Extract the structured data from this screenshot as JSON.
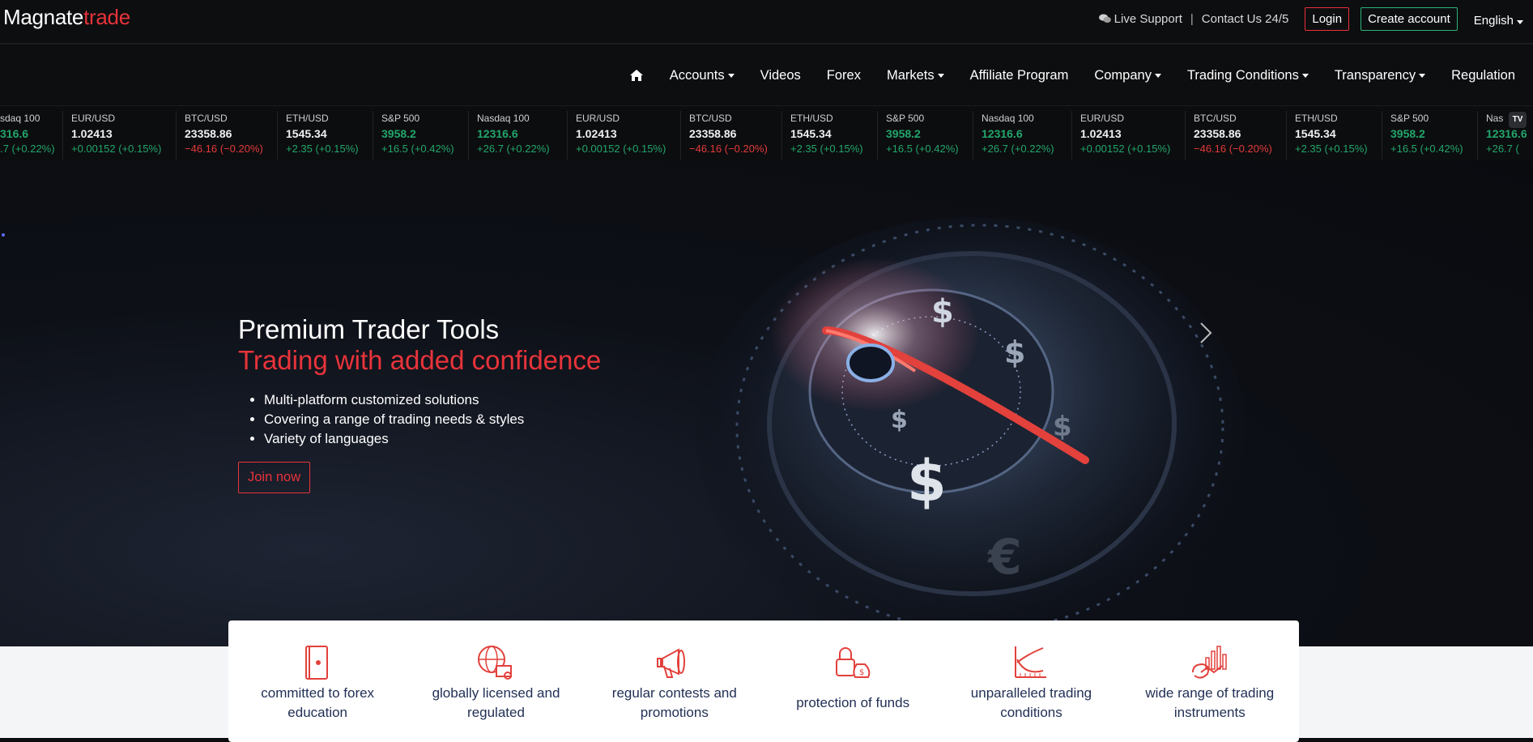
{
  "brand": {
    "part1": "Magnate",
    "part2": "trade"
  },
  "topbar": {
    "live_support": "Live Support",
    "separator": "|",
    "contact": "Contact Us 24/5",
    "login": "Login",
    "create_account": "Create account",
    "language": "English"
  },
  "nav": {
    "items": [
      {
        "label": "Accounts",
        "dropdown": true
      },
      {
        "label": "Videos",
        "dropdown": false
      },
      {
        "label": "Forex",
        "dropdown": false
      },
      {
        "label": "Markets",
        "dropdown": true
      },
      {
        "label": "Affiliate Program",
        "dropdown": false
      },
      {
        "label": "Company",
        "dropdown": true
      },
      {
        "label": "Trading Conditions",
        "dropdown": true
      },
      {
        "label": "Transparency",
        "dropdown": true
      },
      {
        "label": "Regulation",
        "dropdown": false
      }
    ]
  },
  "ticker": {
    "items": [
      {
        "symbol": "sdaq 100",
        "price": "316.6",
        "change": ".7 (+0.22%)",
        "dir": "pos",
        "price_color": "pos"
      },
      {
        "symbol": "EUR/USD",
        "price": "1.02413",
        "change": "+0.00152 (+0.15%)",
        "dir": "pos",
        "price_color": "white"
      },
      {
        "symbol": "BTC/USD",
        "price": "23358.86",
        "change": "−46.16 (−0.20%)",
        "dir": "neg",
        "price_color": "white"
      },
      {
        "symbol": "ETH/USD",
        "price": "1545.34",
        "change": "+2.35 (+0.15%)",
        "dir": "pos",
        "price_color": "white"
      },
      {
        "symbol": "S&P 500",
        "price": "3958.2",
        "change": "+16.5 (+0.42%)",
        "dir": "pos",
        "price_color": "pos"
      },
      {
        "symbol": "Nasdaq 100",
        "price": "12316.6",
        "change": "+26.7 (+0.22%)",
        "dir": "pos",
        "price_color": "pos"
      },
      {
        "symbol": "EUR/USD",
        "price": "1.02413",
        "change": "+0.00152 (+0.15%)",
        "dir": "pos",
        "price_color": "white"
      },
      {
        "symbol": "BTC/USD",
        "price": "23358.86",
        "change": "−46.16 (−0.20%)",
        "dir": "neg",
        "price_color": "white"
      },
      {
        "symbol": "ETH/USD",
        "price": "1545.34",
        "change": "+2.35 (+0.15%)",
        "dir": "pos",
        "price_color": "white"
      },
      {
        "symbol": "S&P 500",
        "price": "3958.2",
        "change": "+16.5 (+0.42%)",
        "dir": "pos",
        "price_color": "pos"
      },
      {
        "symbol": "Nasdaq 100",
        "price": "12316.6",
        "change": "+26.7 (+0.22%)",
        "dir": "pos",
        "price_color": "pos"
      },
      {
        "symbol": "EUR/USD",
        "price": "1.02413",
        "change": "+0.00152 (+0.15%)",
        "dir": "pos",
        "price_color": "white"
      },
      {
        "symbol": "BTC/USD",
        "price": "23358.86",
        "change": "−46.16 (−0.20%)",
        "dir": "neg",
        "price_color": "white"
      },
      {
        "symbol": "ETH/USD",
        "price": "1545.34",
        "change": "+2.35 (+0.15%)",
        "dir": "pos",
        "price_color": "white"
      },
      {
        "symbol": "S&P 500",
        "price": "3958.2",
        "change": "+16.5 (+0.42%)",
        "dir": "pos",
        "price_color": "pos"
      },
      {
        "symbol": "Nas",
        "price": "12316.6",
        "change": "+26.7 (",
        "dir": "pos",
        "price_color": "pos"
      }
    ]
  },
  "hero": {
    "title": "Premium Trader Tools",
    "subtitle": "Trading with added confidence",
    "bullets": [
      "Multi-platform customized solutions",
      "Covering a range of trading needs & styles",
      "Variety of languages"
    ],
    "cta": "Join now"
  },
  "features": [
    {
      "icon": "book-icon",
      "line1": "committed to forex",
      "line2": "education"
    },
    {
      "icon": "globe-certificate-icon",
      "line1": "globally licensed and",
      "line2": "regulated"
    },
    {
      "icon": "megaphone-icon",
      "line1": "regular contests and",
      "line2": "promotions"
    },
    {
      "icon": "lock-moneybag-icon",
      "line1": "protection of funds",
      "line2": ""
    },
    {
      "icon": "chart-growth-icon",
      "line1": "unparalleled trading",
      "line2": "conditions"
    },
    {
      "icon": "instruments-chart-icon",
      "line1": "wide range of trading",
      "line2": "instruments"
    }
  ],
  "colors": {
    "accent_red": "#e8333a",
    "accent_green": "#2bb37a",
    "feature_text": "#223055"
  }
}
